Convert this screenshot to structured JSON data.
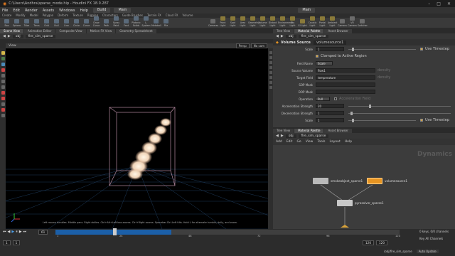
{
  "window": {
    "title": "C:\\Users\\Andhra\\sparse_mode.hip - Houdini FX 18.0.287"
  },
  "menubar": {
    "items": [
      "File",
      "Edit",
      "Render",
      "Assets",
      "Windows",
      "Help"
    ],
    "build_label": "Build",
    "desktop_label": "Main",
    "right_desktop_label": "Main"
  },
  "shelf": {
    "tabs": [
      "Create",
      "Modify",
      "Model",
      "Polygon",
      "Deform",
      "Texture",
      "Rigging",
      "Characters",
      "Guide Brushes",
      "Terrain FX",
      "Cloud FX",
      "Volume"
    ],
    "tools": [
      "Box",
      "Sphere",
      "Tube",
      "Torus",
      "Grid",
      "Null",
      "Line",
      "Circle",
      "Curve",
      "Draw Curve",
      "Path",
      "Spray Paint",
      "Font",
      "Platonic Solids",
      "L-System",
      "Metaball",
      "File"
    ],
    "right_tools": [
      "Cameras",
      "Point Light",
      "Spot Light",
      "Area Light",
      "Geometry Light",
      "Volume Light",
      "Distant Light",
      "Environment Light",
      "Sky Light",
      "GI Light",
      "Caustic Light",
      "Portal Light",
      "Ambient Light",
      "Camera",
      "VR Camera",
      "Switcher",
      "Gamepad Camera",
      "Stereo Camera"
    ]
  },
  "left_pane": {
    "tabs": [
      "Scene View",
      "Animation Editor",
      "Composite View",
      "Motion FX View",
      "Geometry Spreadsheet"
    ],
    "path": [
      "obj",
      "fire_sim_sparse"
    ],
    "view_label": "View",
    "persp_label": "Persp",
    "cam_label": "No cam",
    "hint": "Left mouse tumbles. Middle pans. Right dollies. Ctrl+Alt+Left box-zooms. Ctrl+Right zooms. Spacebar-Ctrl-Left tilts. Hold L for alternate tumble, dolly, and zoom."
  },
  "param_pane": {
    "tabs": [
      "Tree View",
      "Material Palette",
      "Asset Browser"
    ],
    "path": [
      "obj",
      "fire_sim_sparse"
    ],
    "node_type": "Volume Source",
    "node_name": "volumesource1",
    "rows": [
      {
        "label": "Scale",
        "value": "1",
        "flag": "Use Timestep"
      },
      {
        "label": "",
        "value": "Clamped to Active Region",
        "checkbox": true
      },
      {
        "label": "Field Name",
        "value": "Scale",
        "dimmed": false
      },
      {
        "label": "Source Volume",
        "value": "flow1",
        "tag": "density"
      },
      {
        "label": "Target Field",
        "value": "temperature",
        "tag": "density"
      },
      {
        "label": "SOP Mask",
        "value": ""
      },
      {
        "label": "DOP Mask",
        "value": ""
      },
      {
        "label": "Operation",
        "value": "Pull",
        "extra": "Acceleration Field"
      },
      {
        "label": "Acceleration Strength",
        "value": "20"
      },
      {
        "label": "Deceleration Strength",
        "value": "1"
      },
      {
        "label": "Random Strength",
        "value": ""
      },
      {
        "label": "Scale",
        "value": "1",
        "flag": "Use Timestep"
      }
    ]
  },
  "net_pane": {
    "tabs": [
      "Tree View",
      "Material Palette",
      "Asset Browser"
    ],
    "menu": [
      "Add",
      "Edit",
      "Go",
      "View",
      "Tools",
      "Layout",
      "Help"
    ],
    "path": [
      "obj",
      "fire_sim_sparse"
    ],
    "watermark": "Dynamics",
    "nodes": [
      {
        "name": "smokeobject_sparse1"
      },
      {
        "name": "volumesource1"
      },
      {
        "name": "pyrosolver_sparse1"
      }
    ]
  },
  "timeline": {
    "current_frame": "61",
    "start": "1",
    "end": "120",
    "end2": "120",
    "ticks": [
      "1",
      "24",
      "48",
      "72",
      "96",
      "120"
    ],
    "keys_label": "0 keys, 0/0 channels",
    "channels_label": "Key All Channels",
    "path_label": "/obj/fire_sim_sparse",
    "update_label": "Auto Update",
    "progress": 0.51
  },
  "colors": {
    "accent_blue": "#1b5fa8",
    "timeline_orange": "#d8a23a",
    "node_orange": "#e69422",
    "node_gray": "#b9b9b9"
  }
}
